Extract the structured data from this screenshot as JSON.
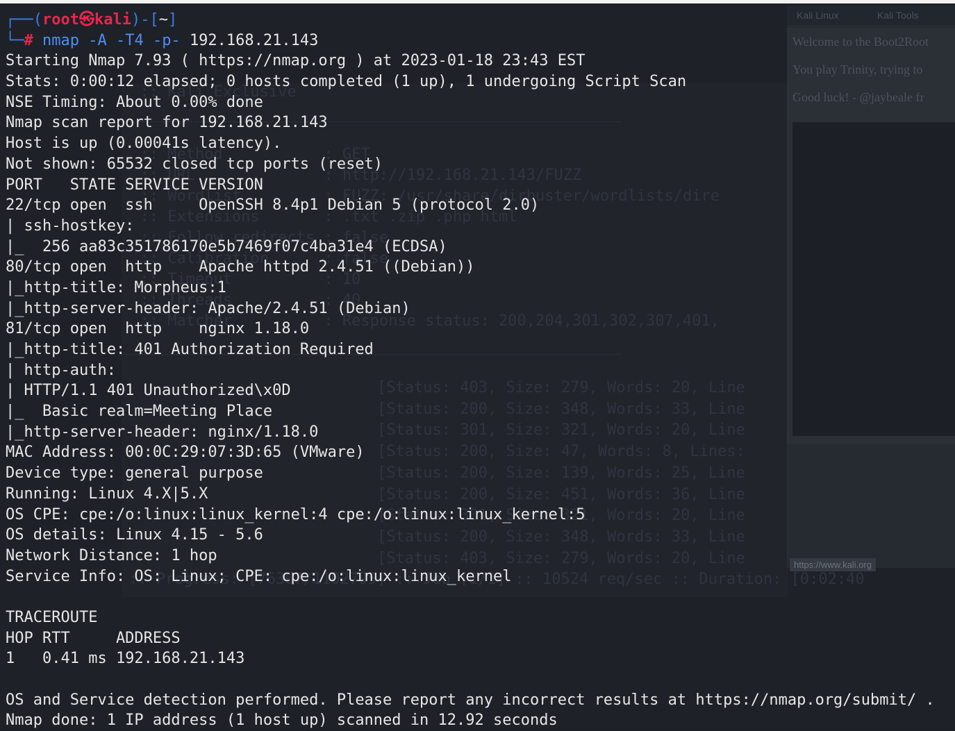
{
  "prompt": {
    "corner_top": "┌──(",
    "user": "root",
    "at_symbol": "㉿",
    "host": "kali",
    "close_paren": ")-[",
    "dir": "~",
    "close_bracket": "]",
    "corner_bottom": "└─",
    "hash": "#",
    "command": "nmap",
    "flags": "-A -T4 -p-",
    "target": "192.168.21.143"
  },
  "output_lines": [
    "Starting Nmap 7.93 ( https://nmap.org ) at 2023-01-18 23:43 EST",
    "Stats: 0:00:12 elapsed; 0 hosts completed (1 up), 1 undergoing Script Scan",
    "NSE Timing: About 0.00% done",
    "Nmap scan report for 192.168.21.143",
    "Host is up (0.00041s latency).",
    "Not shown: 65532 closed tcp ports (reset)",
    "PORT   STATE SERVICE VERSION",
    "22/tcp open  ssh     OpenSSH 8.4p1 Debian 5 (protocol 2.0)",
    "| ssh-hostkey: ",
    "|_  256 aa83c351786170e5b7469f07c4ba31e4 (ECDSA)",
    "80/tcp open  http    Apache httpd 2.4.51 ((Debian))",
    "|_http-title: Morpheus:1",
    "|_http-server-header: Apache/2.4.51 (Debian)",
    "81/tcp open  http    nginx 1.18.0",
    "|_http-title: 401 Authorization Required",
    "| http-auth: ",
    "| HTTP/1.1 401 Unauthorized\\x0D",
    "|_  Basic realm=Meeting Place",
    "|_http-server-header: nginx/1.18.0",
    "MAC Address: 00:0C:29:07:3D:65 (VMware)",
    "Device type: general purpose",
    "Running: Linux 4.X|5.X",
    "OS CPE: cpe:/o:linux:linux_kernel:4 cpe:/o:linux:linux_kernel:5",
    "OS details: Linux 4.15 - 5.6",
    "Network Distance: 1 hop",
    "Service Info: OS: Linux; CPE: cpe:/o:linux:linux_kernel",
    "",
    "TRACEROUTE",
    "HOP RTT     ADDRESS",
    "1   0.41 ms 192.168.21.143",
    "",
    "OS and Service detection performed. Please report any incorrect results at https://nmap.org/submit/ .",
    "Nmap done: 1 IP address (1 host up) scanned in 12.92 seconds"
  ],
  "background_terminal": {
    "lines": [
      "  :: Kali Exclusive",
      "",
      "  :: Method           : GET",
      "  :: URL              : http://192.168.21.143/FUZZ",
      "  :: Wordlist         : FUZZ: /usr/share/dirbuster/wordlists/dire",
      "  :: Extensions       : .txt .zip .php html",
      "  :: Follow redirects : false",
      "  :: Calibration      : false",
      "  :: Timeout          : 10",
      "  :: Threads          : 40",
      "  :: Matcher          : Response status: 200,204,301,302,307,401,"
    ],
    "results": [
      "[Status: 403, Size: 279, Words: 20, Line",
      "[Status: 200, Size: 348, Words: 33, Line",
      "[Status: 301, Size: 321, Words: 20, Line",
      "[Status: 200, Size: 47, Words: 8, Lines:",
      "[Status: 200, Size: 139, Words: 25, Line",
      "[Status: 200, Size: 451, Words: 36, Line",
      "[Status: 301, Size: 321, Words: 20, Line",
      "[Status: 200, Size: 348, Words: 33, Line",
      "[Status: 403, Size: 279, Words: 20, Line"
    ],
    "progress": ":: Progress: [76367/1102795] :: Job [1/1] :: 10524 req/sec :: Duration: [0:02:40"
  },
  "background_browser": {
    "tabs": [
      "Kali Linux",
      "Kali Tools"
    ],
    "page_lines": [
      "Welcome to the Boot2Root",
      "You play Trinity, trying to",
      "Good luck! - @jaybeale fr"
    ],
    "status_url": "https://www.kali.org"
  },
  "colors": {
    "background": "#1e2128",
    "text": "#e6e6e6",
    "prompt_blue": "#3d7de0",
    "prompt_red": "#e8264c",
    "command_blue": "#4f8ef0"
  }
}
